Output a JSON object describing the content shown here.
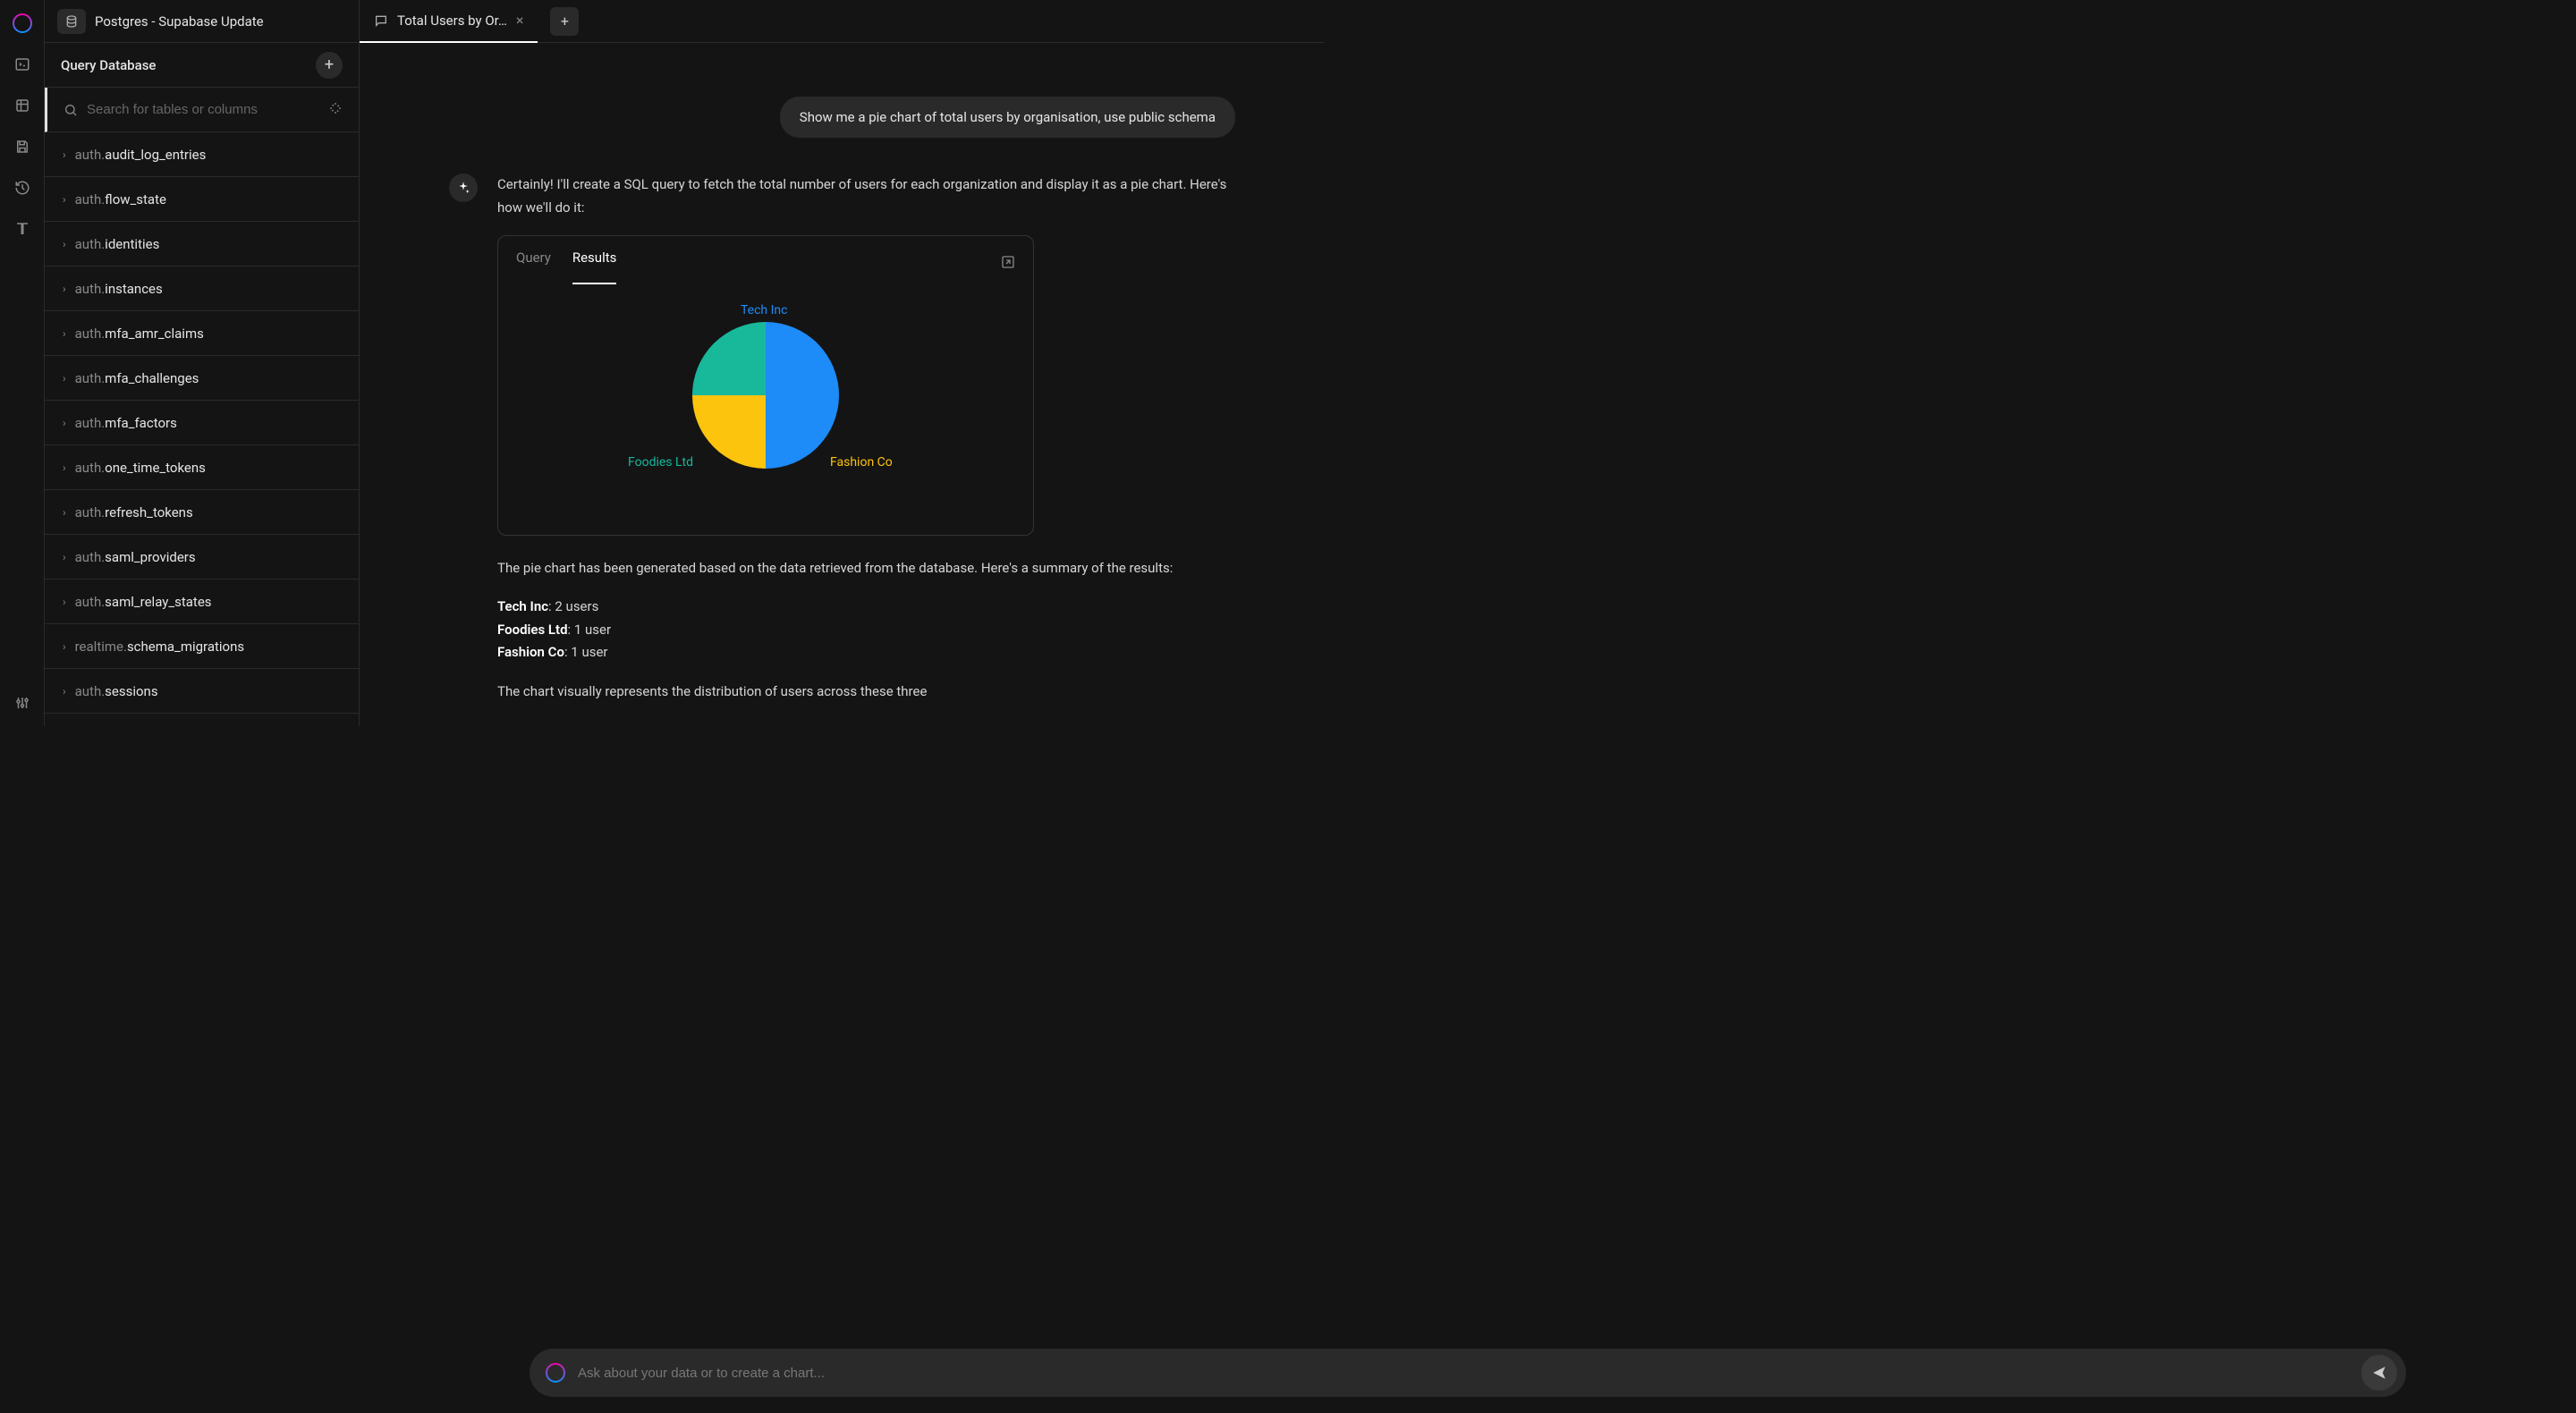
{
  "header": {
    "db_title": "Postgres - Supabase Update"
  },
  "panel": {
    "title": "Query Database",
    "search_placeholder": "Search for tables or columns"
  },
  "tables": [
    {
      "schema": "auth.",
      "name": "audit_log_entries"
    },
    {
      "schema": "auth.",
      "name": "flow_state"
    },
    {
      "schema": "auth.",
      "name": "identities"
    },
    {
      "schema": "auth.",
      "name": "instances"
    },
    {
      "schema": "auth.",
      "name": "mfa_amr_claims"
    },
    {
      "schema": "auth.",
      "name": "mfa_challenges"
    },
    {
      "schema": "auth.",
      "name": "mfa_factors"
    },
    {
      "schema": "auth.",
      "name": "one_time_tokens"
    },
    {
      "schema": "auth.",
      "name": "refresh_tokens"
    },
    {
      "schema": "auth.",
      "name": "saml_providers"
    },
    {
      "schema": "auth.",
      "name": "saml_relay_states"
    },
    {
      "schema": "realtime.",
      "name": "schema_migrations"
    },
    {
      "schema": "auth.",
      "name": "sessions"
    }
  ],
  "tabs": {
    "active": "Total Users by Or…"
  },
  "chat": {
    "user_message": "Show me a pie chart of total users by organisation, use public schema",
    "ai_intro": "Certainly! I'll create a SQL query to fetch the total number of users for each organization and display it as a pie chart. Here's how we'll do it:",
    "result_tabs": {
      "query": "Query",
      "results": "Results"
    },
    "ai_summary_intro": "The pie chart has been generated based on the data retrieved from the database. Here's a summary of the results:",
    "summary": [
      {
        "label": "Tech Inc",
        "value": ": 2 users"
      },
      {
        "label": "Foodies Ltd",
        "value": ": 1 user"
      },
      {
        "label": "Fashion Co",
        "value": ": 1 user"
      }
    ],
    "ai_outro": "The chart visually represents the distribution of users across these three",
    "input_placeholder": "Ask about your data or to create a chart..."
  },
  "chart_data": {
    "type": "pie",
    "title": "Total Users by Organisation",
    "series": [
      {
        "name": "Tech Inc",
        "value": 2,
        "color": "#1d8bf8"
      },
      {
        "name": "Fashion Co",
        "value": 1,
        "color": "#fdc40e"
      },
      {
        "name": "Foodies Ltd",
        "value": 1,
        "color": "#18b89b"
      }
    ]
  }
}
